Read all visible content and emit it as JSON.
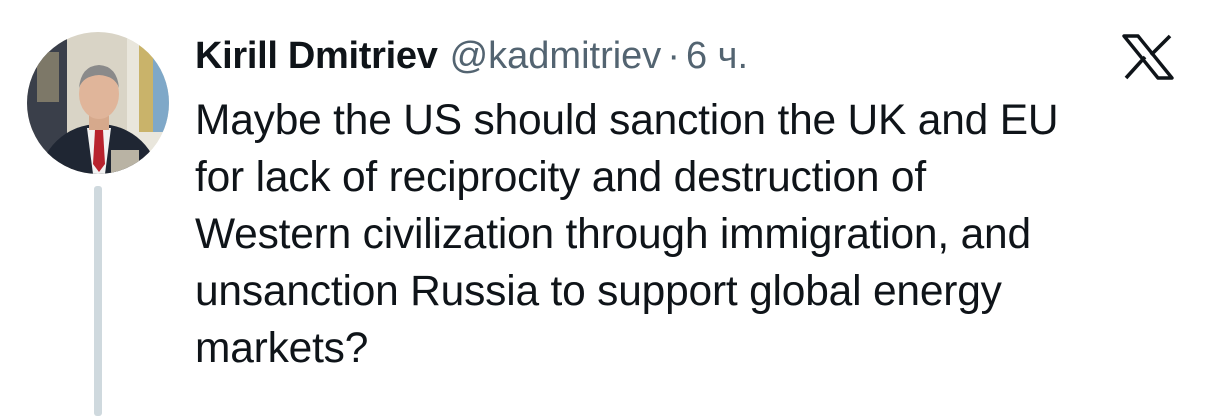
{
  "author": {
    "name": "Kirill Dmitriev",
    "handle": "@kadmitriev",
    "separator": "·",
    "time": "6 ч."
  },
  "tweet": {
    "text": "Maybe the US should sanction the UK and EU\nfor lack of reciprocity and destruction of\nWestern civilization through immigration, and\nunsanction Russia to support global energy\nmarkets?"
  },
  "icons": {
    "brand": "x-logo-icon"
  },
  "colors": {
    "text_primary": "#0f1419",
    "text_secondary": "#536471",
    "thread_line": "#cfd9de",
    "background": "#ffffff"
  }
}
